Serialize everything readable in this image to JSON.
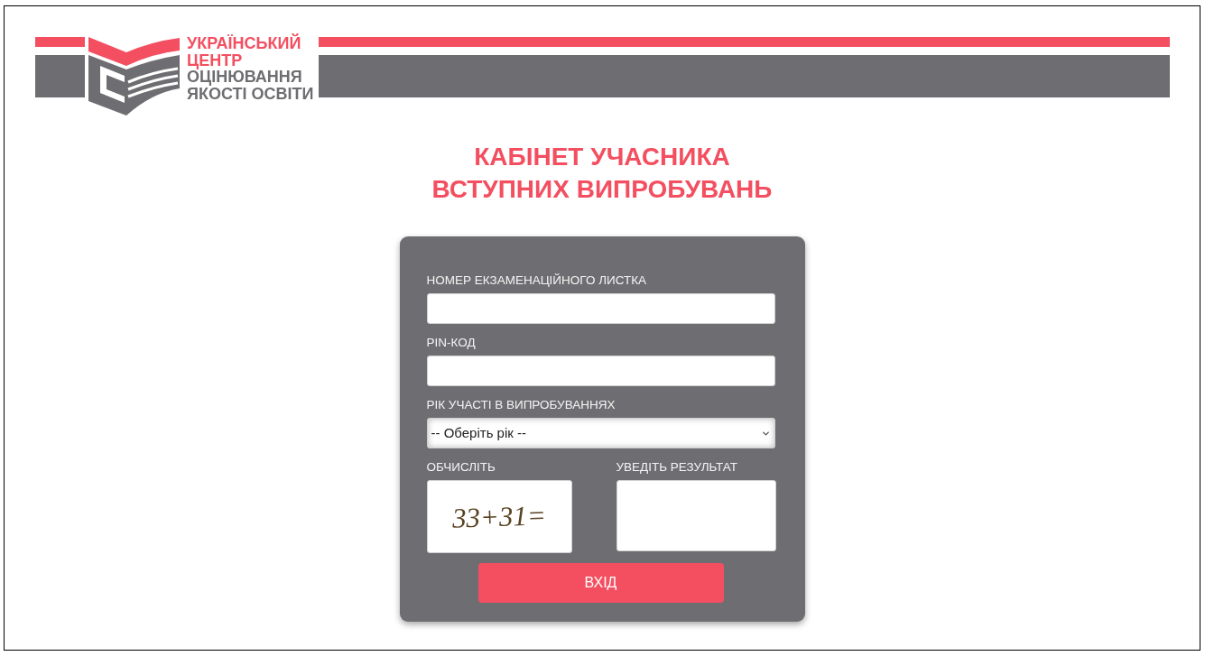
{
  "header": {
    "logo": {
      "lines": [
        {
          "text": "УКРАЇНСЬКИЙ",
          "color": "#f34f60"
        },
        {
          "text": "ЦЕНТР",
          "color": "#f34f60"
        },
        {
          "text": "ОЦІНЮВАННЯ",
          "color": "#6e6e72"
        },
        {
          "text": "ЯКОСТІ ОСВІТИ",
          "color": "#6e6e72"
        }
      ]
    }
  },
  "title": [
    "КАБІНЕТ УЧАСНИКА",
    "ВСТУПНИХ ВИПРОБУВАНЬ"
  ],
  "form": {
    "fields": [
      {
        "kind": "text",
        "label": "НОМЕР ЕКЗАМЕНАЦІЙНОГО ЛИСТКА"
      },
      {
        "kind": "text",
        "label": "PIN-КОД"
      },
      {
        "kind": "select",
        "label": "РІК УЧАСТІ В ВИПРОБУВАННЯХ",
        "value": "-- Оберіть рік --"
      }
    ],
    "captcha": {
      "label": "ОБЧИСЛІТЬ",
      "text": "33+31="
    },
    "result": {
      "label": "УВЕДІТЬ РЕЗУЛЬТАТ"
    },
    "submit": "ВХІД"
  }
}
